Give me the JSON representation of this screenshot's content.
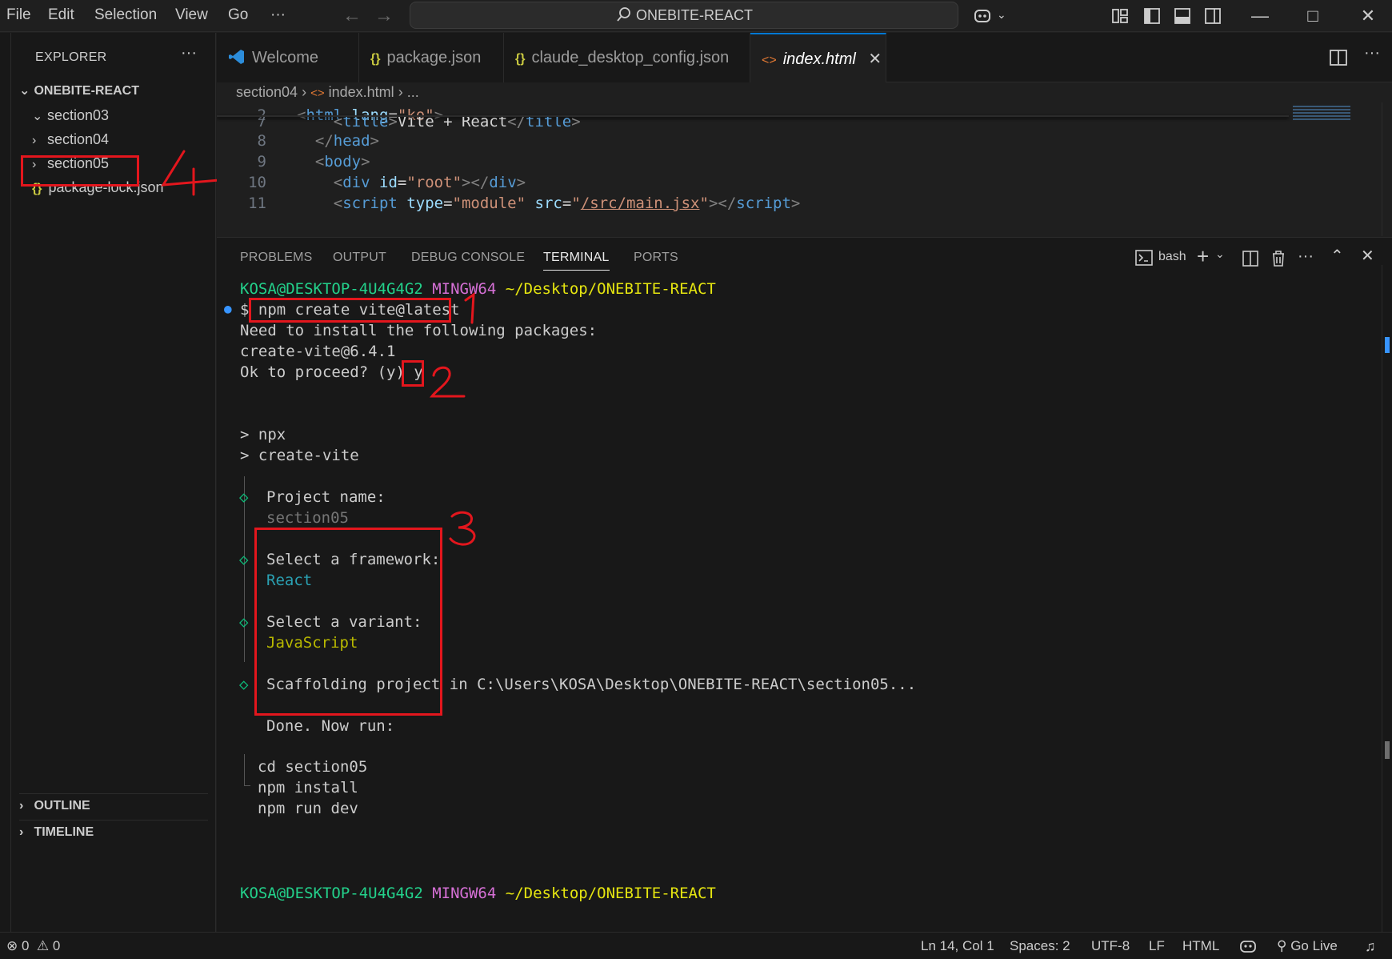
{
  "menu": [
    "File",
    "Edit",
    "Selection",
    "View",
    "Go",
    "···"
  ],
  "search": {
    "text": "ONEBITE-REACT"
  },
  "sidebar": {
    "header": "EXPLORER",
    "more": "···",
    "root": "ONEBITE-REACT",
    "items": [
      {
        "label": "section03",
        "expanded": true
      },
      {
        "label": "section04",
        "expanded": false
      },
      {
        "label": "section05",
        "expanded": false
      },
      {
        "label": "package-lock.json",
        "type": "json"
      }
    ],
    "outline": "OUTLINE",
    "timeline": "TIMELINE"
  },
  "tabs": [
    {
      "label": "Welcome"
    },
    {
      "label": "package.json"
    },
    {
      "label": "claude_desktop_config.json"
    },
    {
      "label": "index.html",
      "active": true
    }
  ],
  "breadcrumb": {
    "folder": "section04",
    "file": "index.html",
    "more": "..."
  },
  "code": {
    "lines": [
      "2",
      "7",
      "8",
      "9",
      "10",
      "11"
    ],
    "html_lang": "ko",
    "title_text": "Vite + React",
    "div_id": "root",
    "script_type": "module",
    "script_src": "/src/main.jsx"
  },
  "panel": {
    "tabs": [
      "PROBLEMS",
      "OUTPUT",
      "DEBUG CONSOLE",
      "TERMINAL",
      "PORTS"
    ],
    "active_tab": "TERMINAL",
    "shell": "bash"
  },
  "terminal": {
    "user": "KOSA@DESKTOP-4U4G4G2",
    "env": "MINGW64",
    "path": "~/Desktop/ONEBITE-REACT",
    "prompt": "$",
    "command": "npm create vite@latest",
    "line_install": "Need to install the following packages:",
    "line_pkg": "create-vite@6.4.1",
    "line_proceed": "Ok to proceed? (y)",
    "answer": "y",
    "npx": "> npx",
    "create_vite": "> create-vite",
    "q_name": "Project name:",
    "a_name": "section05",
    "q_framework": "Select a framework:",
    "a_framework": "React",
    "q_variant": "Select a variant:",
    "a_variant": "JavaScript",
    "scaffold": "Scaffolding project in C:\\Users\\KOSA\\Desktop\\ONEBITE-REACT\\section05...",
    "done": "Done. Now run:",
    "cmd1": "cd section05",
    "cmd2": "npm install",
    "cmd3": "npm run dev"
  },
  "annotations": {
    "a1": "1",
    "a2": "2",
    "a3": "3",
    "a4": "4"
  },
  "statusbar": {
    "errors": "0",
    "warnings": "0",
    "position": "Ln 14, Col 1",
    "spaces": "Spaces: 2",
    "encoding": "UTF-8",
    "eol": "LF",
    "language": "HTML",
    "golive": "Go Live"
  },
  "colors": {
    "accent": "#0078d4",
    "annotation": "#e3161d",
    "prompt_user": "#23d18b",
    "prompt_env": "#d670d6",
    "prompt_path": "#e5e510"
  }
}
